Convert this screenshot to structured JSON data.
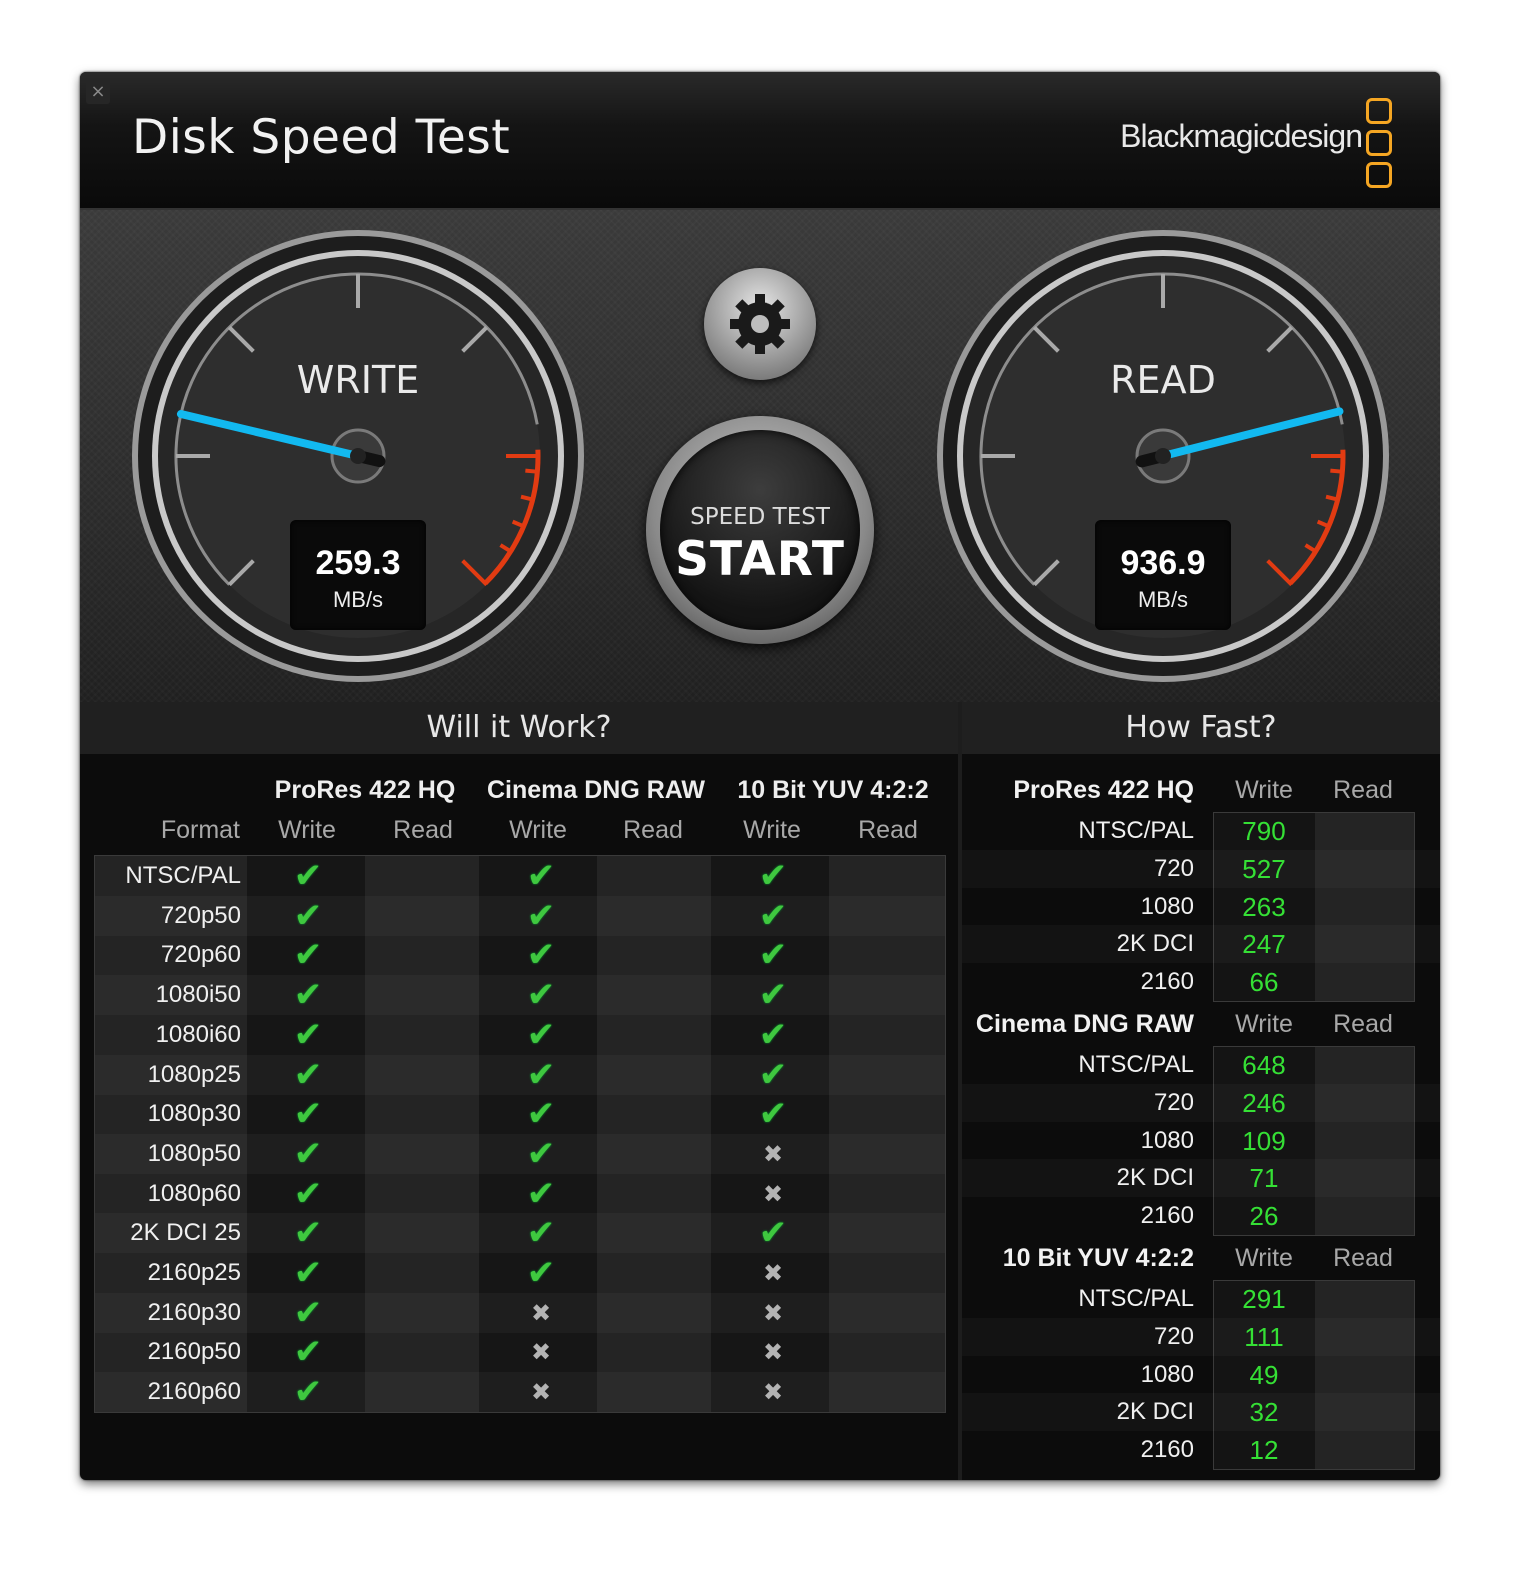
{
  "window": {
    "title": "Disk Speed Test",
    "close_icon": "close-icon",
    "brand": "Blackmagicdesign",
    "brand_color": "#f5a623"
  },
  "gauges": {
    "write": {
      "label": "WRITE",
      "value": "259.3",
      "unit": "MB/s"
    },
    "read": {
      "label": "READ",
      "value": "936.9",
      "unit": "MB/s"
    },
    "needle_color": "#12b9f0",
    "redline_color": "#e23b12"
  },
  "controls": {
    "settings_icon": "gear-icon",
    "start_small": "SPEED TEST",
    "start_big": "START"
  },
  "will_it_work": {
    "title": "Will it Work?",
    "format_header": "Format",
    "groups": [
      "ProRes 422 HQ",
      "Cinema DNG RAW",
      "10 Bit YUV 4:2:2"
    ],
    "subheaders": [
      "Write",
      "Read",
      "Write",
      "Read",
      "Write",
      "Read"
    ],
    "rows": [
      {
        "format": "NTSC/PAL",
        "write": [
          "check",
          "check",
          "check"
        ]
      },
      {
        "format": "720p50",
        "write": [
          "check",
          "check",
          "check"
        ]
      },
      {
        "format": "720p60",
        "write": [
          "check",
          "check",
          "check"
        ]
      },
      {
        "format": "1080i50",
        "write": [
          "check",
          "check",
          "check"
        ]
      },
      {
        "format": "1080i60",
        "write": [
          "check",
          "check",
          "check"
        ]
      },
      {
        "format": "1080p25",
        "write": [
          "check",
          "check",
          "check"
        ]
      },
      {
        "format": "1080p30",
        "write": [
          "check",
          "check",
          "check"
        ]
      },
      {
        "format": "1080p50",
        "write": [
          "check",
          "check",
          "cross"
        ]
      },
      {
        "format": "1080p60",
        "write": [
          "check",
          "check",
          "cross"
        ]
      },
      {
        "format": "2K DCI 25",
        "write": [
          "check",
          "check",
          "check"
        ]
      },
      {
        "format": "2160p25",
        "write": [
          "check",
          "check",
          "cross"
        ]
      },
      {
        "format": "2160p30",
        "write": [
          "check",
          "cross",
          "cross"
        ]
      },
      {
        "format": "2160p50",
        "write": [
          "check",
          "cross",
          "cross"
        ]
      },
      {
        "format": "2160p60",
        "write": [
          "check",
          "cross",
          "cross"
        ]
      }
    ],
    "check_symbol": "✔",
    "cross_symbol": "✖"
  },
  "how_fast": {
    "title": "How Fast?",
    "value_color": "#35e035",
    "groups": [
      {
        "name": "ProRes 422 HQ",
        "write_header": "Write",
        "read_header": "Read",
        "rows": [
          {
            "label": "NTSC/PAL",
            "write": "790"
          },
          {
            "label": "720",
            "write": "527"
          },
          {
            "label": "1080",
            "write": "263"
          },
          {
            "label": "2K DCI",
            "write": "247"
          },
          {
            "label": "2160",
            "write": "66"
          }
        ]
      },
      {
        "name": "Cinema DNG RAW",
        "write_header": "Write",
        "read_header": "Read",
        "rows": [
          {
            "label": "NTSC/PAL",
            "write": "648"
          },
          {
            "label": "720",
            "write": "246"
          },
          {
            "label": "1080",
            "write": "109"
          },
          {
            "label": "2K DCI",
            "write": "71"
          },
          {
            "label": "2160",
            "write": "26"
          }
        ]
      },
      {
        "name": "10 Bit YUV 4:2:2",
        "write_header": "Write",
        "read_header": "Read",
        "rows": [
          {
            "label": "NTSC/PAL",
            "write": "291"
          },
          {
            "label": "720",
            "write": "111"
          },
          {
            "label": "1080",
            "write": "49"
          },
          {
            "label": "2K DCI",
            "write": "32"
          },
          {
            "label": "2160",
            "write": "12"
          }
        ]
      }
    ]
  }
}
